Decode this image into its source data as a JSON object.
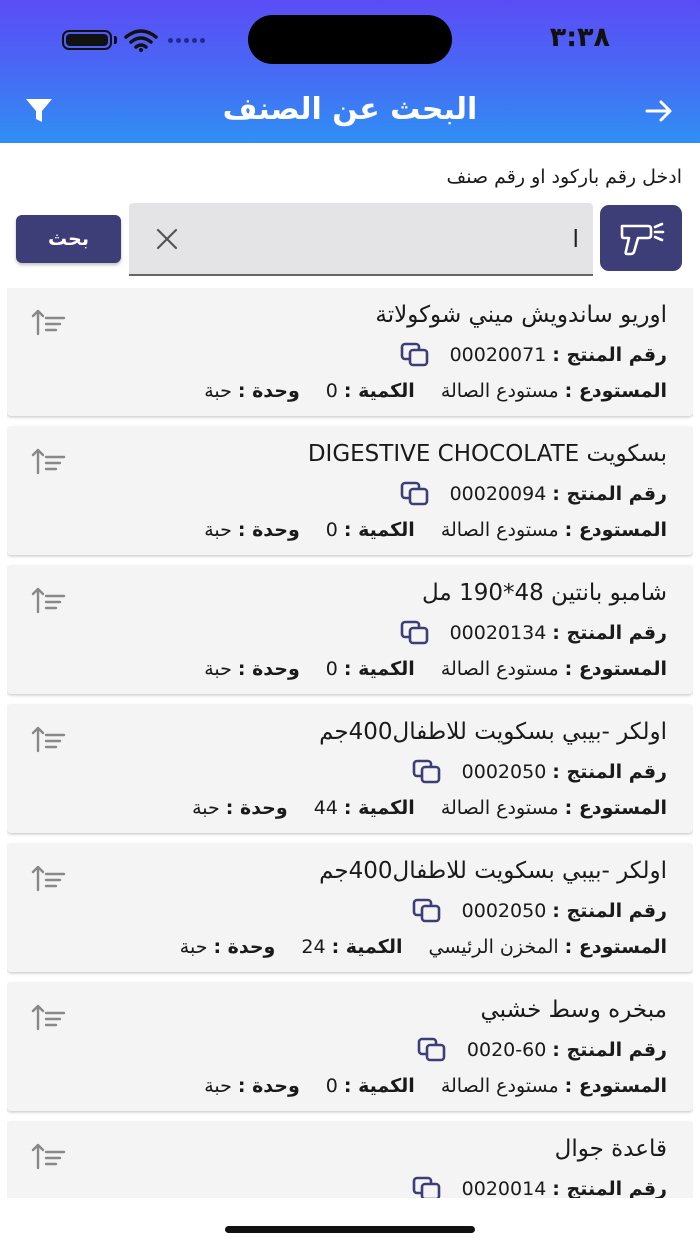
{
  "status_bar": {
    "time": "٣:٣٨"
  },
  "header": {
    "title": "البحث عن الصنف"
  },
  "search": {
    "hint": "ادخل رقم باركود او رقم صنف",
    "value": "ا",
    "button_label": "بحث"
  },
  "labels": {
    "product_number": "رقم المنتج :",
    "warehouse": "المستودع :",
    "quantity": "الكمية :",
    "unit": "وحدة :"
  },
  "items": [
    {
      "name": "اوريو ساندويش ميني شوكولاتة",
      "number": "00020071",
      "warehouse": "مستودع الصالة",
      "quantity": "0",
      "unit": "حبة"
    },
    {
      "name": "بسكويت DIGESTIVE CHOCOLATE",
      "number": "00020094",
      "warehouse": "مستودع الصالة",
      "quantity": "0",
      "unit": "حبة"
    },
    {
      "name": "شامبو بانتين 48*190 مل",
      "number": "00020134",
      "warehouse": "مستودع الصالة",
      "quantity": "0",
      "unit": "حبة"
    },
    {
      "name": "اولكر -بيبي بسكويت للاطفال400جم",
      "number": "0002050",
      "warehouse": "مستودع الصالة",
      "quantity": "44",
      "unit": "حبة"
    },
    {
      "name": "اولكر -بيبي بسكويت للاطفال400جم",
      "number": "0002050",
      "warehouse": "المخزن الرئيسي",
      "quantity": "24",
      "unit": "حبة"
    },
    {
      "name": "مبخره وسط خشبي",
      "number": "0020-60",
      "warehouse": "مستودع الصالة",
      "quantity": "0",
      "unit": "حبة"
    },
    {
      "name": "قاعدة جوال",
      "number": "0020014",
      "warehouse": "",
      "quantity": "",
      "unit": ""
    }
  ],
  "colors": {
    "accent": "#3d3d78",
    "header_top": "#5a4df5",
    "header_bottom": "#2f8ff4"
  }
}
